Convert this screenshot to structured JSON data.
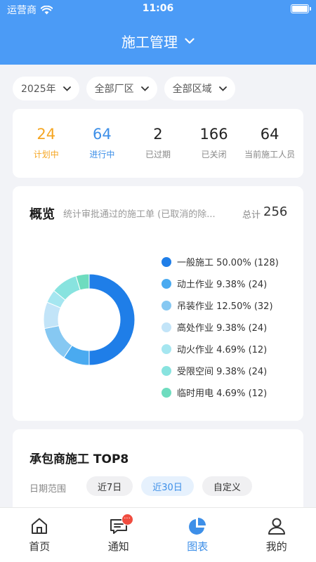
{
  "status_bar": {
    "carrier": "运营商",
    "time": "11:06"
  },
  "header": {
    "title": "施工管理"
  },
  "filters": [
    "2025年",
    "全部厂区",
    "全部区域"
  ],
  "stats": [
    {
      "value": "24",
      "label": "计划中",
      "color": "#f5a623"
    },
    {
      "value": "64",
      "label": "进行中",
      "color": "#3d8fe8"
    },
    {
      "value": "2",
      "label": "已过期"
    },
    {
      "value": "166",
      "label": "已关闭"
    },
    {
      "value": "64",
      "label": "当前施工人员"
    }
  ],
  "overview": {
    "title": "概览",
    "description": "统计审批通过的施工单 (已取消的除...",
    "total_label": "总计",
    "total": "256"
  },
  "chart_data": {
    "type": "pie",
    "categories": [
      "一般施工",
      "动土作业",
      "吊装作业",
      "高处作业",
      "动火作业",
      "受限空间",
      "临时用电"
    ],
    "values": [
      128,
      24,
      32,
      24,
      12,
      24,
      12
    ],
    "legend_labels": [
      "一般施工 50.00% (128)",
      "动土作业 9.38% (24)",
      "吊装作业 12.50% (32)",
      "高处作业 9.38% (24)",
      "动火作业 4.69% (12)",
      "受限空间 9.38% (24)",
      "临时用电 4.69% (12)"
    ],
    "colors": [
      "#1f7ee8",
      "#4aaaf0",
      "#86c8f2",
      "#c2e4f8",
      "#a5e6f0",
      "#88e3df",
      "#6edcbf"
    ],
    "legend_position": "right"
  },
  "top_section": {
    "title": "承包商施工 TOP8",
    "range_label": "日期范围",
    "ranges": [
      "近7日",
      "近30日",
      "自定义"
    ],
    "active_range": "近30日"
  },
  "tabbar": {
    "items": [
      "首页",
      "通知",
      "图表",
      "我的"
    ],
    "active": "图表",
    "badge": "···"
  }
}
